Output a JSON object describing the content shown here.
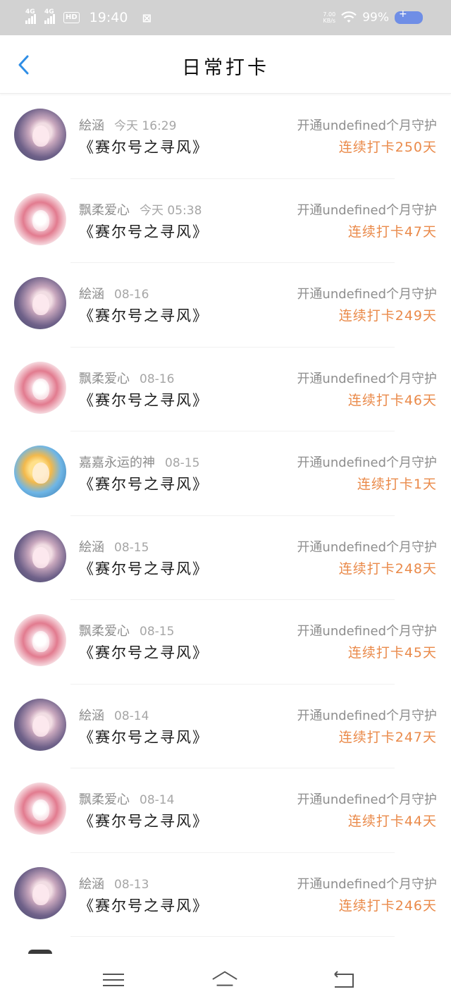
{
  "status_bar": {
    "signal1_label": "4G",
    "signal2_label": "4G",
    "hd_label": "HD",
    "time": "19:40",
    "net_speed_value": "7.00",
    "net_speed_unit": "KB/s",
    "battery": "99%"
  },
  "header": {
    "title": "日常打卡",
    "back_icon": "chevron-left-icon"
  },
  "rows": [
    {
      "name": "絵涵",
      "date": "今天 16:29",
      "book": "《赛尔号之寻风》",
      "guard": "开通undefined个月守护",
      "streak": "连续打卡250天",
      "avatar": "a"
    },
    {
      "name": "飘柔爱心",
      "date": "今天 05:38",
      "book": "《赛尔号之寻风》",
      "guard": "开通undefined个月守护",
      "streak": "连续打卡47天",
      "avatar": "b"
    },
    {
      "name": "絵涵",
      "date": "08-16",
      "book": "《赛尔号之寻风》",
      "guard": "开通undefined个月守护",
      "streak": "连续打卡249天",
      "avatar": "a"
    },
    {
      "name": "飘柔爱心",
      "date": "08-16",
      "book": "《赛尔号之寻风》",
      "guard": "开通undefined个月守护",
      "streak": "连续打卡46天",
      "avatar": "b"
    },
    {
      "name": "嘉嘉永运的神",
      "date": "08-15",
      "book": "《赛尔号之寻风》",
      "guard": "开通undefined个月守护",
      "streak": "连续打卡1天",
      "avatar": "c"
    },
    {
      "name": "絵涵",
      "date": "08-15",
      "book": "《赛尔号之寻风》",
      "guard": "开通undefined个月守护",
      "streak": "连续打卡248天",
      "avatar": "a"
    },
    {
      "name": "飘柔爱心",
      "date": "08-15",
      "book": "《赛尔号之寻风》",
      "guard": "开通undefined个月守护",
      "streak": "连续打卡45天",
      "avatar": "b"
    },
    {
      "name": "絵涵",
      "date": "08-14",
      "book": "《赛尔号之寻风》",
      "guard": "开通undefined个月守护",
      "streak": "连续打卡247天",
      "avatar": "a"
    },
    {
      "name": "飘柔爱心",
      "date": "08-14",
      "book": "《赛尔号之寻风》",
      "guard": "开通undefined个月守护",
      "streak": "连续打卡44天",
      "avatar": "b"
    },
    {
      "name": "絵涵",
      "date": "08-13",
      "book": "《赛尔号之寻风》",
      "guard": "开通undefined个月守护",
      "streak": "连续打卡246天",
      "avatar": "a"
    }
  ],
  "nav": {
    "menu_icon": "menu-icon",
    "home_icon": "home-icon",
    "back_icon": "back-arrow-icon"
  },
  "colors": {
    "accent": "#2f8ee6",
    "streak": "#ea8a4a",
    "status_bar_bg": "#d2d2d2"
  }
}
